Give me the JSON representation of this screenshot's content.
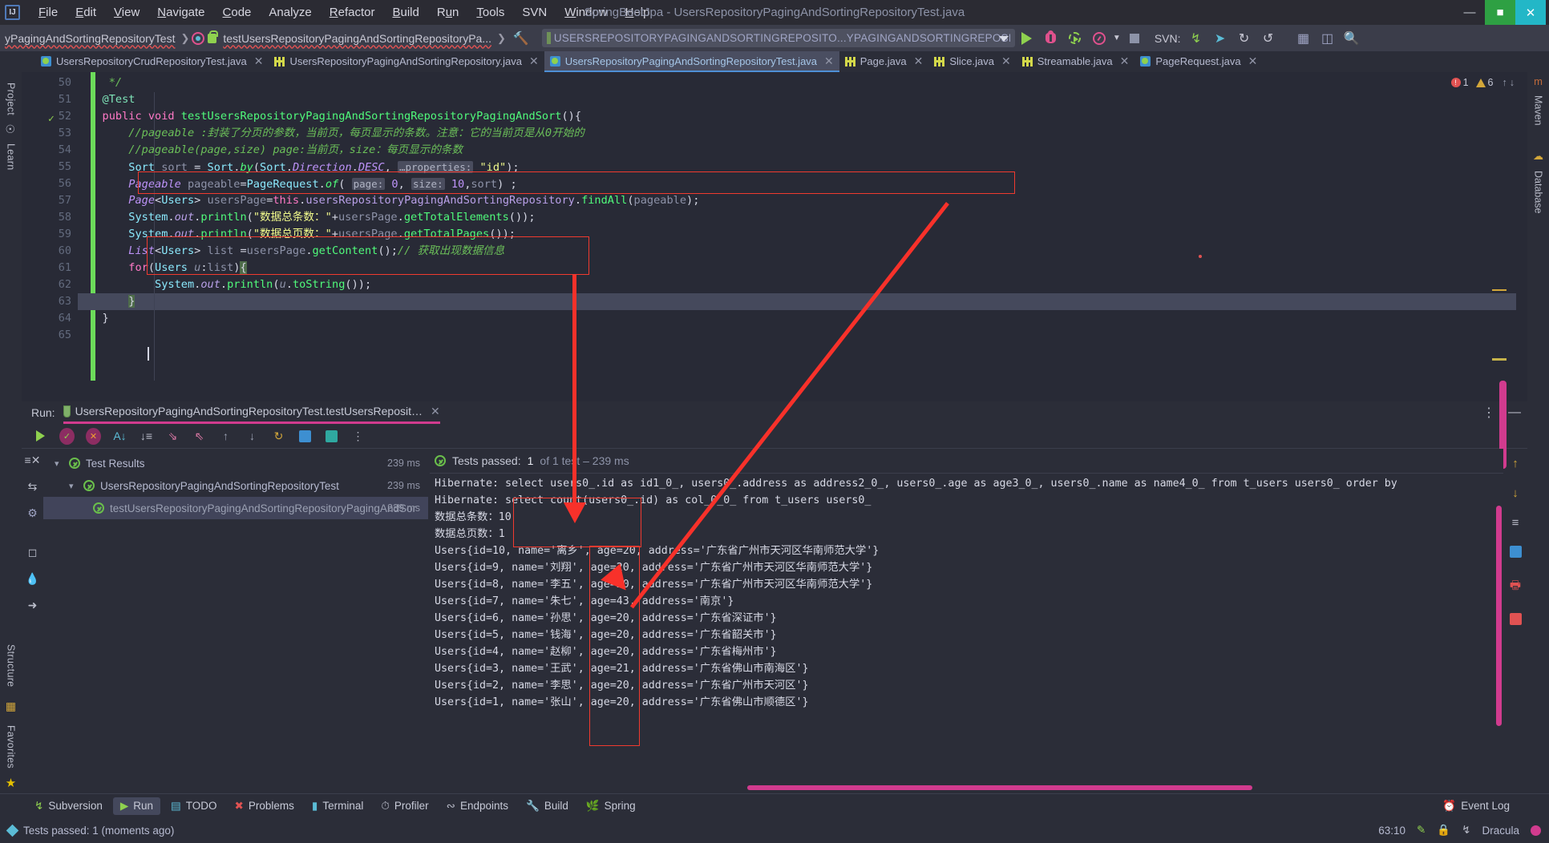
{
  "window": {
    "title": "SpringBootJpa - UsersRepositoryPagingAndSortingRepositoryTest.java",
    "minimize": "—",
    "maximize": "❐",
    "close": "✕"
  },
  "menu": {
    "logo": "IJ",
    "items": [
      "File",
      "Edit",
      "View",
      "Navigate",
      "Code",
      "Analyze",
      "Refactor",
      "Build",
      "Run",
      "Tools",
      "SVN",
      "Window",
      "Help"
    ]
  },
  "navbar": {
    "breadcrumb": [
      "yPagingAndSortingRepositoryTest",
      "testUsersRepositoryPagingAndSortingRepositoryPa..."
    ],
    "run_config": "USERSREPOSITORYPAGINGANDSORTINGREPOSITO...YPAGINGANDSORTINGREPOSITORYPAGINGANDSORT",
    "svn_label": "SVN:"
  },
  "editor_tabs": [
    {
      "label": "UsersRepositoryCrudRepositoryTest.java",
      "icon": "test-class-icon",
      "active": false
    },
    {
      "label": "UsersRepositoryPagingAndSortingRepository.java",
      "icon": "interface-icon",
      "active": false
    },
    {
      "label": "UsersRepositoryPagingAndSortingRepositoryTest.java",
      "icon": "test-class-icon",
      "active": true
    },
    {
      "label": "Page.java",
      "icon": "interface-icon",
      "active": false
    },
    {
      "label": "Slice.java",
      "icon": "interface-icon",
      "active": false
    },
    {
      "label": "Streamable.java",
      "icon": "interface-icon",
      "active": false
    },
    {
      "label": "PageRequest.java",
      "icon": "class-icon",
      "active": false
    }
  ],
  "inspection": {
    "errors": "1",
    "warnings": "6"
  },
  "left_rail": {
    "top": [
      "Project",
      "Learn"
    ],
    "bottom": [
      "Structure",
      "Favorites"
    ]
  },
  "right_rail": [
    "Maven",
    "Database"
  ],
  "code": {
    "lines": [
      {
        "n": "50",
        "text": "    */"
      },
      {
        "n": "51",
        "text": "   @Test"
      },
      {
        "n": "52",
        "text": "   public void testUsersRepositoryPagingAndSortingRepositoryPagingAndSort(){"
      },
      {
        "n": "53",
        "text": "       //pageable :封装了分页的参数，当前页，每页显示的条数。注意：它的当前页是从0开始的"
      },
      {
        "n": "54",
        "text": "       //pageable(page,size) page:当前页，size：每页显示的条数"
      },
      {
        "n": "55",
        "text": "       Sort sort = Sort.by(Sort.Direction.DESC, …properties: \"id\");"
      },
      {
        "n": "56",
        "text": "       Pageable pageable=PageRequest.of( page: 0, size: 10,sort) ;"
      },
      {
        "n": "57",
        "text": "       Page<Users> usersPage=this.usersRepositoryPagingAndSortingRepository.findAll(pageable);"
      },
      {
        "n": "58",
        "text": "       System.out.println(\"数据总条数：\"+usersPage.getTotalElements());"
      },
      {
        "n": "59",
        "text": "       System.out.println(\"数据总页数：\"+usersPage.getTotalPages());"
      },
      {
        "n": "60",
        "text": "       List<Users> list =usersPage.getContent();// 获取出现数据信息"
      },
      {
        "n": "61",
        "text": "       for(Users u:list){"
      },
      {
        "n": "62",
        "text": "           System.out.println(u.toString());"
      },
      {
        "n": "63",
        "text": "       }"
      },
      {
        "n": "64",
        "text": "   }"
      },
      {
        "n": "65",
        "text": ""
      }
    ]
  },
  "run_panel": {
    "label": "Run:",
    "tab_title": "UsersRepositoryPagingAndSortingRepositoryTest.testUsersReposit…",
    "toolbar_icons": [
      "rerun-icon",
      "show-passed-icon",
      "hide-passed-icon",
      "sort-alpha-icon",
      "sort-duration-icon",
      "expand-all-icon",
      "collapse-all-icon",
      "prev-failed-icon",
      "next-failed-icon",
      "history-icon",
      "export-icon",
      "open-icon",
      "more-options-icon"
    ],
    "tree": [
      {
        "label": "Test Results",
        "time": "239 ms",
        "level": 0,
        "selected": false
      },
      {
        "label": "UsersRepositoryPagingAndSortingRepositoryTest",
        "time": "239 ms",
        "level": 1,
        "selected": false
      },
      {
        "label": "testUsersRepositoryPagingAndSortingRepositoryPagingAndSor",
        "time": "239 ms",
        "level": 2,
        "selected": true
      }
    ],
    "status": {
      "passed_text": "Tests passed: ",
      "passed_count": "1",
      "detail": "of 1 test – 239 ms"
    },
    "console": [
      "Hibernate: select users0_.id as id1_0_, users0_.address as address2_0_, users0_.age as age3_0_, users0_.name as name4_0_ from t_users users0_ order by",
      "Hibernate: select count(users0_.id) as col_0_0_ from t_users users0_",
      "数据总条数：10",
      "数据总页数：1",
      "Users{id=10, name='离乡', age=20, address='广东省广州市天河区华南师范大学'}",
      "Users{id=9, name='刘翔', age=20, address='广东省广州市天河区华南师范大学'}",
      "Users{id=8, name='李五', age=20, address='广东省广州市天河区华南师范大学'}",
      "Users{id=7, name='朱七', age=43, address='南京'}",
      "Users{id=6, name='孙思', age=20, address='广东省深证市'}",
      "Users{id=5, name='钱海', age=20, address='广东省韶关市'}",
      "Users{id=4, name='赵柳', age=20, address='广东省梅州市'}",
      "Users{id=3, name='王武', age=21, address='广东省佛山市南海区'}",
      "Users{id=2, name='李思', age=20, address='广东省广州市天河区'}",
      "Users{id=1, name='张山', age=20, address='广东省佛山市顺德区'}"
    ]
  },
  "bottom_bar": [
    {
      "label": "Subversion",
      "icon": "branch-icon",
      "active": false
    },
    {
      "label": "Run",
      "icon": "play-icon",
      "active": true
    },
    {
      "label": "TODO",
      "icon": "checklist-icon",
      "active": false
    },
    {
      "label": "Problems",
      "icon": "error-icon",
      "active": false
    },
    {
      "label": "Terminal",
      "icon": "terminal-icon",
      "active": false
    },
    {
      "label": "Profiler",
      "icon": "gauge-icon",
      "active": false
    },
    {
      "label": "Endpoints",
      "icon": "endpoints-icon",
      "active": false
    },
    {
      "label": "Build",
      "icon": "hammer-icon",
      "active": false
    },
    {
      "label": "Spring",
      "icon": "spring-icon",
      "active": false
    }
  ],
  "event_log": "Event Log",
  "status_bar": {
    "message": "Tests passed: 1 (moments ago)",
    "caret_position": "63:10",
    "theme": "Dracula"
  },
  "colors": {
    "accent_pink": "#d13b8e",
    "annotation_red": "#f8312a",
    "green_ok": "#6abf4b",
    "editor_bg": "#282a36",
    "panel_bg": "#2b2d38"
  }
}
